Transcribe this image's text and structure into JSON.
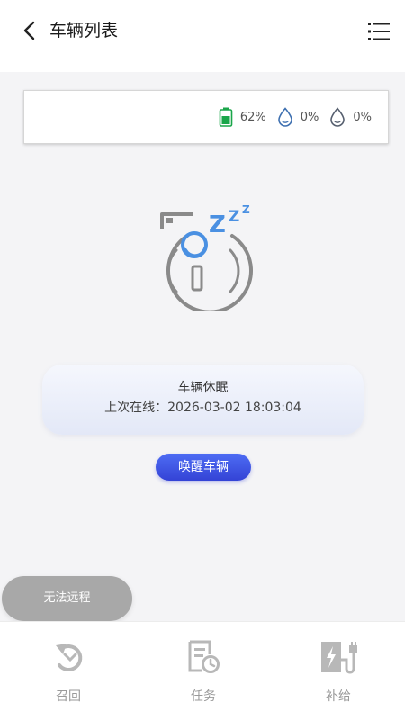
{
  "header": {
    "title": "车辆列表"
  },
  "status": {
    "battery": "62%",
    "water1": "0%",
    "water2": "0%"
  },
  "sleep": {
    "title": "车辆休眠",
    "last_online_label": "上次在线：",
    "last_online_time": "2026-03-02 18:03:04"
  },
  "wake_button": "唤醒车辆",
  "notice": "无法远程",
  "tabs": {
    "recall": "召回",
    "task": "任务",
    "supply": "补给"
  },
  "colors": {
    "accent": "#3443d6",
    "battery": "#1aa64a",
    "water": "#3d6fb0",
    "illustration": "#4a90e2"
  },
  "icons": [
    "back-arrow-icon",
    "list-menu-icon",
    "battery-icon",
    "water-drop-icon",
    "sleeping-robot-icon",
    "recall-icon",
    "task-icon",
    "supply-charge-icon"
  ]
}
